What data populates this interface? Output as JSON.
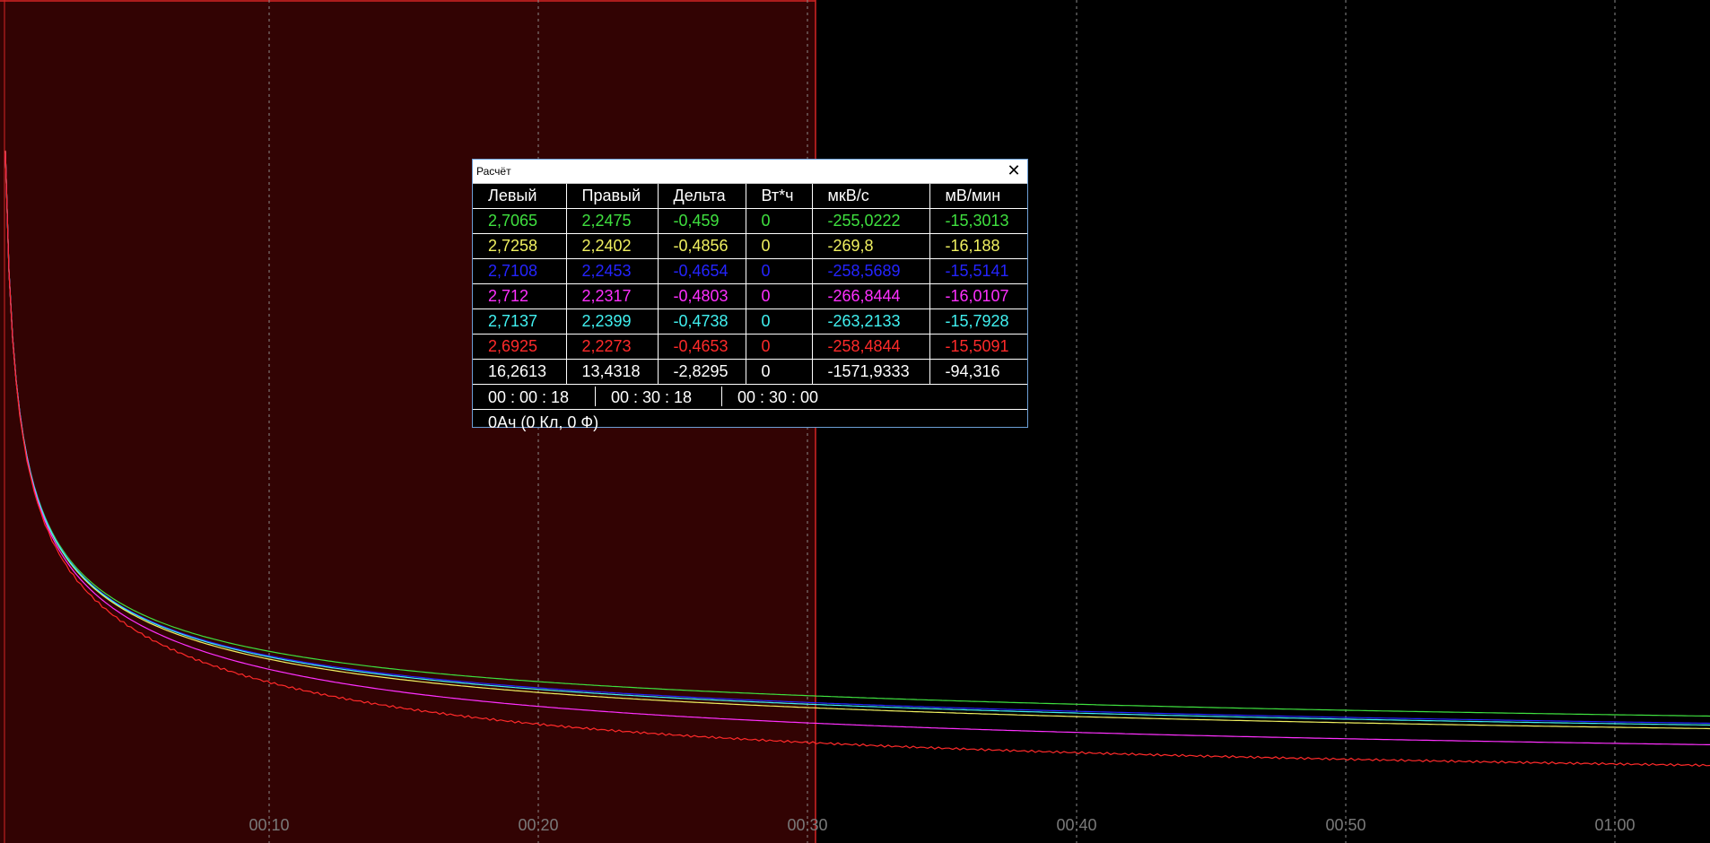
{
  "plot": {
    "x_tick_labels": [
      "00:10",
      "00:20",
      "00:30",
      "00:40",
      "00:50",
      "01:00"
    ],
    "colors": {
      "background": "#000000",
      "selection_fill": "#320303",
      "selection_border": "#d42525",
      "grid": "#8a8a8a",
      "tick_label": "#7a7a7a"
    },
    "series_colors": [
      "#3fe03f",
      "#f0f060",
      "#2424ff",
      "#ff30ff",
      "#40f0f0",
      "#ff2a2a",
      "#ffffff"
    ],
    "curve_shape": "exponential-like decay of all channels from start toward 01:00"
  },
  "calc_window": {
    "title": "Расчёт",
    "close_icon": "✕",
    "headers": [
      "Левый",
      "Правый",
      "Дельта",
      "Вт*ч",
      "мкВ/с",
      "мВ/мин"
    ],
    "rows": [
      {
        "color": "#3fe03f",
        "cells": [
          "2,7065",
          "2,2475",
          "-0,459",
          "0",
          "-255,0222",
          "-15,3013"
        ]
      },
      {
        "color": "#f0f060",
        "cells": [
          "2,7258",
          "2,2402",
          "-0,4856",
          "0",
          "-269,8",
          "-16,188"
        ]
      },
      {
        "color": "#2424ff",
        "cells": [
          "2,7108",
          "2,2453",
          "-0,4654",
          "0",
          "-258,5689",
          "-15,5141"
        ]
      },
      {
        "color": "#ff30ff",
        "cells": [
          "2,712",
          "2,2317",
          "-0,4803",
          "0",
          "-266,8444",
          "-16,0107"
        ]
      },
      {
        "color": "#40f0f0",
        "cells": [
          "2,7137",
          "2,2399",
          "-0,4738",
          "0",
          "-263,2133",
          "-15,7928"
        ]
      },
      {
        "color": "#ff2a2a",
        "cells": [
          "2,6925",
          "2,2273",
          "-0,4653",
          "0",
          "-258,4844",
          "-15,5091"
        ]
      },
      {
        "color": "#ffffff",
        "cells": [
          "16,2613",
          "13,4318",
          "-2,8295",
          "0",
          "-1571,9333",
          "-94,316"
        ]
      }
    ],
    "times": {
      "left": "00 : 00 : 18",
      "right": "00 : 30 : 18",
      "delta": "00 : 30 : 00"
    },
    "charge": "0Ач (0 Кл, 0 Ф)"
  }
}
